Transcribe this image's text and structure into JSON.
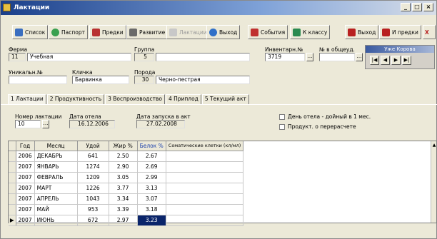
{
  "window": {
    "title": "Лактации"
  },
  "toolbar": {
    "buttons": [
      {
        "label": "Список",
        "color": "#3a6ec0"
      },
      {
        "label": "Паспорт",
        "color": "#3aa050"
      },
      {
        "label": "Предки",
        "color": "#b83030"
      },
      {
        "label": "Развитие",
        "color": "#6a6a6a"
      },
      {
        "label": "Лактации",
        "color": "#a0a0a0"
      },
      {
        "label": "Выход",
        "color": "#3070c8"
      },
      {
        "label": "События",
        "color": "#c03030"
      },
      {
        "label": "К классу",
        "color": "#2a8a50"
      },
      {
        "label": "Выход",
        "color": "#b82020"
      },
      {
        "label": "И предки",
        "color": "#b82020"
      },
      {
        "label": "Х",
        "color": "#b82020"
      }
    ]
  },
  "form": {
    "farm_label": "Ферма",
    "farm_code": "11",
    "farm_name": "Учебная",
    "group_label": "Группа",
    "group_value": "5",
    "inventory_label": "Инвентарн.№",
    "inventory_value": "3719",
    "herdbook_label": "№ в общеуд.",
    "unique_label": "Уникальн.№",
    "nickname_label": "Кличка",
    "nickname_value": "Барвинка",
    "breed_label": "Порода",
    "breed_code": "30",
    "breed_name": "Черно-пестрая"
  },
  "navigator": {
    "title": "Уже Корова"
  },
  "tabs": [
    "1 Лактации",
    "2 Продуктивность",
    "3 Воспроизводство",
    "4 Приплод",
    "5 Текущий акт"
  ],
  "lactation": {
    "number_label": "Номер лактации",
    "number_value": "10",
    "calving_label": "Дата отела",
    "calving_value": "16.12.2006",
    "start_label": "Дата запуска в акт",
    "start_value": "27.02.2008",
    "check_days": "День отела - дойный в 1 мес.",
    "check_recalc": "Продукт. о перерасчете"
  },
  "table": {
    "headers": [
      "Год",
      "Месяц",
      "Удой",
      "Жир %",
      "Белок %",
      "Соматические клетки (кл/мл)"
    ],
    "rows": [
      [
        "2006",
        "ДЕКАБРЬ",
        "641",
        "2.50",
        "2.67"
      ],
      [
        "2007",
        "ЯНВАРЬ",
        "1274",
        "2.90",
        "2.69"
      ],
      [
        "2007",
        "ФЕВРАЛЬ",
        "1209",
        "3.05",
        "2.99"
      ],
      [
        "2007",
        "МАРТ",
        "1226",
        "3.77",
        "3.13"
      ],
      [
        "2007",
        "АПРЕЛЬ",
        "1043",
        "3.34",
        "3.07"
      ],
      [
        "2007",
        "МАЙ",
        "953",
        "3.39",
        "3.18"
      ],
      [
        "2007",
        "ИЮНЬ",
        "672",
        "2.97",
        "3.23"
      ]
    ]
  }
}
